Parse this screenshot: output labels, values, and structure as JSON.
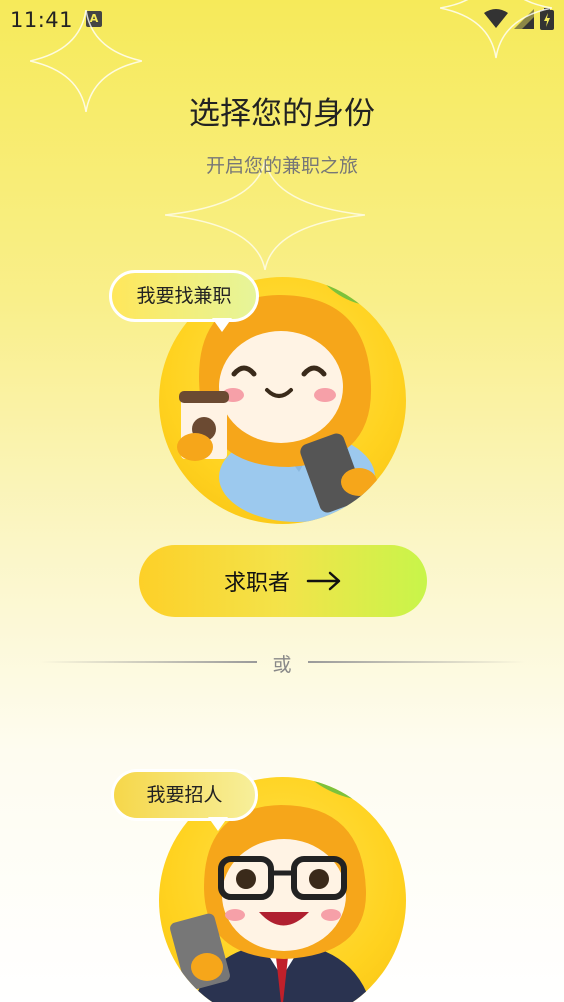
{
  "status_bar": {
    "time": "11:41",
    "notification_icon": "A"
  },
  "header": {
    "title": "选择您的身份",
    "subtitle": "开启您的兼职之旅"
  },
  "job_seeker": {
    "bubble": "我要找兼职",
    "button_label": "求职者",
    "arrow": "⟶"
  },
  "separator": {
    "label": "或"
  },
  "recruiter": {
    "bubble": "我要招人"
  },
  "colors": {
    "accent_yellow": "#ffd21f",
    "accent_green": "#c8f54a",
    "mango": "#f6a61a",
    "leaf": "#7cc23c"
  }
}
